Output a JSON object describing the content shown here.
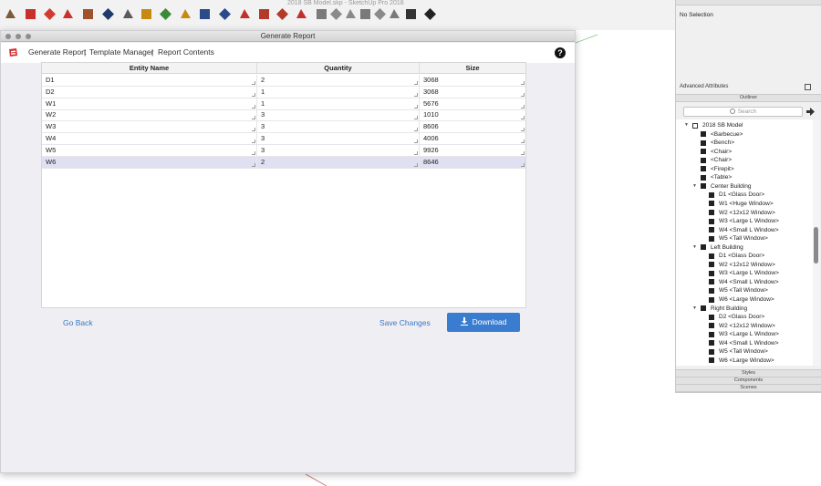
{
  "app": {
    "window_title": "2018 SB Model.skp - SketchUp Pro 2018"
  },
  "toolbar": {
    "icons": [
      "select-tool",
      "paint-tool",
      "move-tool",
      "rotate-tool",
      "push-pull-tool",
      "tape-measure-tool",
      "text-tool",
      "orbit-tool",
      "pan-tool",
      "protractor-tool",
      "zoom-tool",
      "zoom-extents-tool",
      "3d-warehouse",
      "extension-warehouse",
      "extension-manager",
      "ruby-console",
      "view-iso",
      "view-top",
      "view-front",
      "view-right",
      "view-back",
      "view-left",
      "shaded-style",
      "display-toggle"
    ]
  },
  "dialog": {
    "title": "Generate Report",
    "nav": {
      "generate_report": "Generate Report",
      "sep1": "|",
      "template_manager": "Template Manager",
      "sep2": "|",
      "report_contents": "Report Contents"
    },
    "help": "?",
    "table": {
      "columns": [
        "Entity Name",
        "Quantity",
        "Size"
      ],
      "rows": [
        {
          "name": "D1",
          "quantity": "2",
          "size": "3068"
        },
        {
          "name": "D2",
          "quantity": "1",
          "size": "3068"
        },
        {
          "name": "W1",
          "quantity": "1",
          "size": "5676"
        },
        {
          "name": "W2",
          "quantity": "3",
          "size": "1010"
        },
        {
          "name": "W3",
          "quantity": "3",
          "size": "8606"
        },
        {
          "name": "W4",
          "quantity": "3",
          "size": "4006"
        },
        {
          "name": "W5",
          "quantity": "3",
          "size": "9926"
        },
        {
          "name": "W6",
          "quantity": "2",
          "size": "8646"
        }
      ]
    },
    "go_back": "Go Back",
    "save_changes": "Save Changes",
    "download": "Download"
  },
  "panel": {
    "no_selection": "No Selection",
    "advanced_attributes": "Advanced Attributes",
    "outliner_title": "Outliner",
    "search_placeholder": "Search",
    "tree": [
      {
        "label": "2018 SB Model",
        "level": 0,
        "expanded": true,
        "kind": "model"
      },
      {
        "label": "<Barbecue>",
        "level": 1,
        "kind": "component"
      },
      {
        "label": "<Bench>",
        "level": 1,
        "kind": "component"
      },
      {
        "label": "<Chair>",
        "level": 1,
        "kind": "component"
      },
      {
        "label": "<Chair>",
        "level": 1,
        "kind": "component"
      },
      {
        "label": "<Firepit>",
        "level": 1,
        "kind": "component"
      },
      {
        "label": "<Table>",
        "level": 1,
        "kind": "component"
      },
      {
        "label": "Center Building",
        "level": 1,
        "expanded": true,
        "kind": "group"
      },
      {
        "label": "D1 <Glass Door>",
        "level": 2,
        "kind": "component"
      },
      {
        "label": "W1 <Huge Window>",
        "level": 2,
        "kind": "component"
      },
      {
        "label": "W2 <12x12 Window>",
        "level": 2,
        "kind": "component"
      },
      {
        "label": "W3 <Large L Window>",
        "level": 2,
        "kind": "component"
      },
      {
        "label": "W4 <Small L Window>",
        "level": 2,
        "kind": "component"
      },
      {
        "label": "W5 <Tall Window>",
        "level": 2,
        "kind": "component"
      },
      {
        "label": "Left Building",
        "level": 1,
        "expanded": true,
        "kind": "group"
      },
      {
        "label": "D1 <Glass Door>",
        "level": 2,
        "kind": "component"
      },
      {
        "label": "W2 <12x12 Window>",
        "level": 2,
        "kind": "component"
      },
      {
        "label": "W3 <Large L Window>",
        "level": 2,
        "kind": "component"
      },
      {
        "label": "W4 <Small L Window>",
        "level": 2,
        "kind": "component"
      },
      {
        "label": "W5 <Tall Window>",
        "level": 2,
        "kind": "component"
      },
      {
        "label": "W6 <Large Window>",
        "level": 2,
        "kind": "component"
      },
      {
        "label": "Right Building",
        "level": 1,
        "expanded": true,
        "kind": "group"
      },
      {
        "label": "D2 <Glass Door>",
        "level": 2,
        "kind": "component"
      },
      {
        "label": "W2 <12x12 Window>",
        "level": 2,
        "kind": "component"
      },
      {
        "label": "W3 <Large L Window>",
        "level": 2,
        "kind": "component"
      },
      {
        "label": "W4 <Small L Window>",
        "level": 2,
        "kind": "component"
      },
      {
        "label": "W5 <Tall Window>",
        "level": 2,
        "kind": "component"
      },
      {
        "label": "W6 <Large Window>",
        "level": 2,
        "kind": "component"
      }
    ],
    "styles_title": "Styles",
    "components_title": "Components",
    "scenes_title": "Scenes"
  }
}
